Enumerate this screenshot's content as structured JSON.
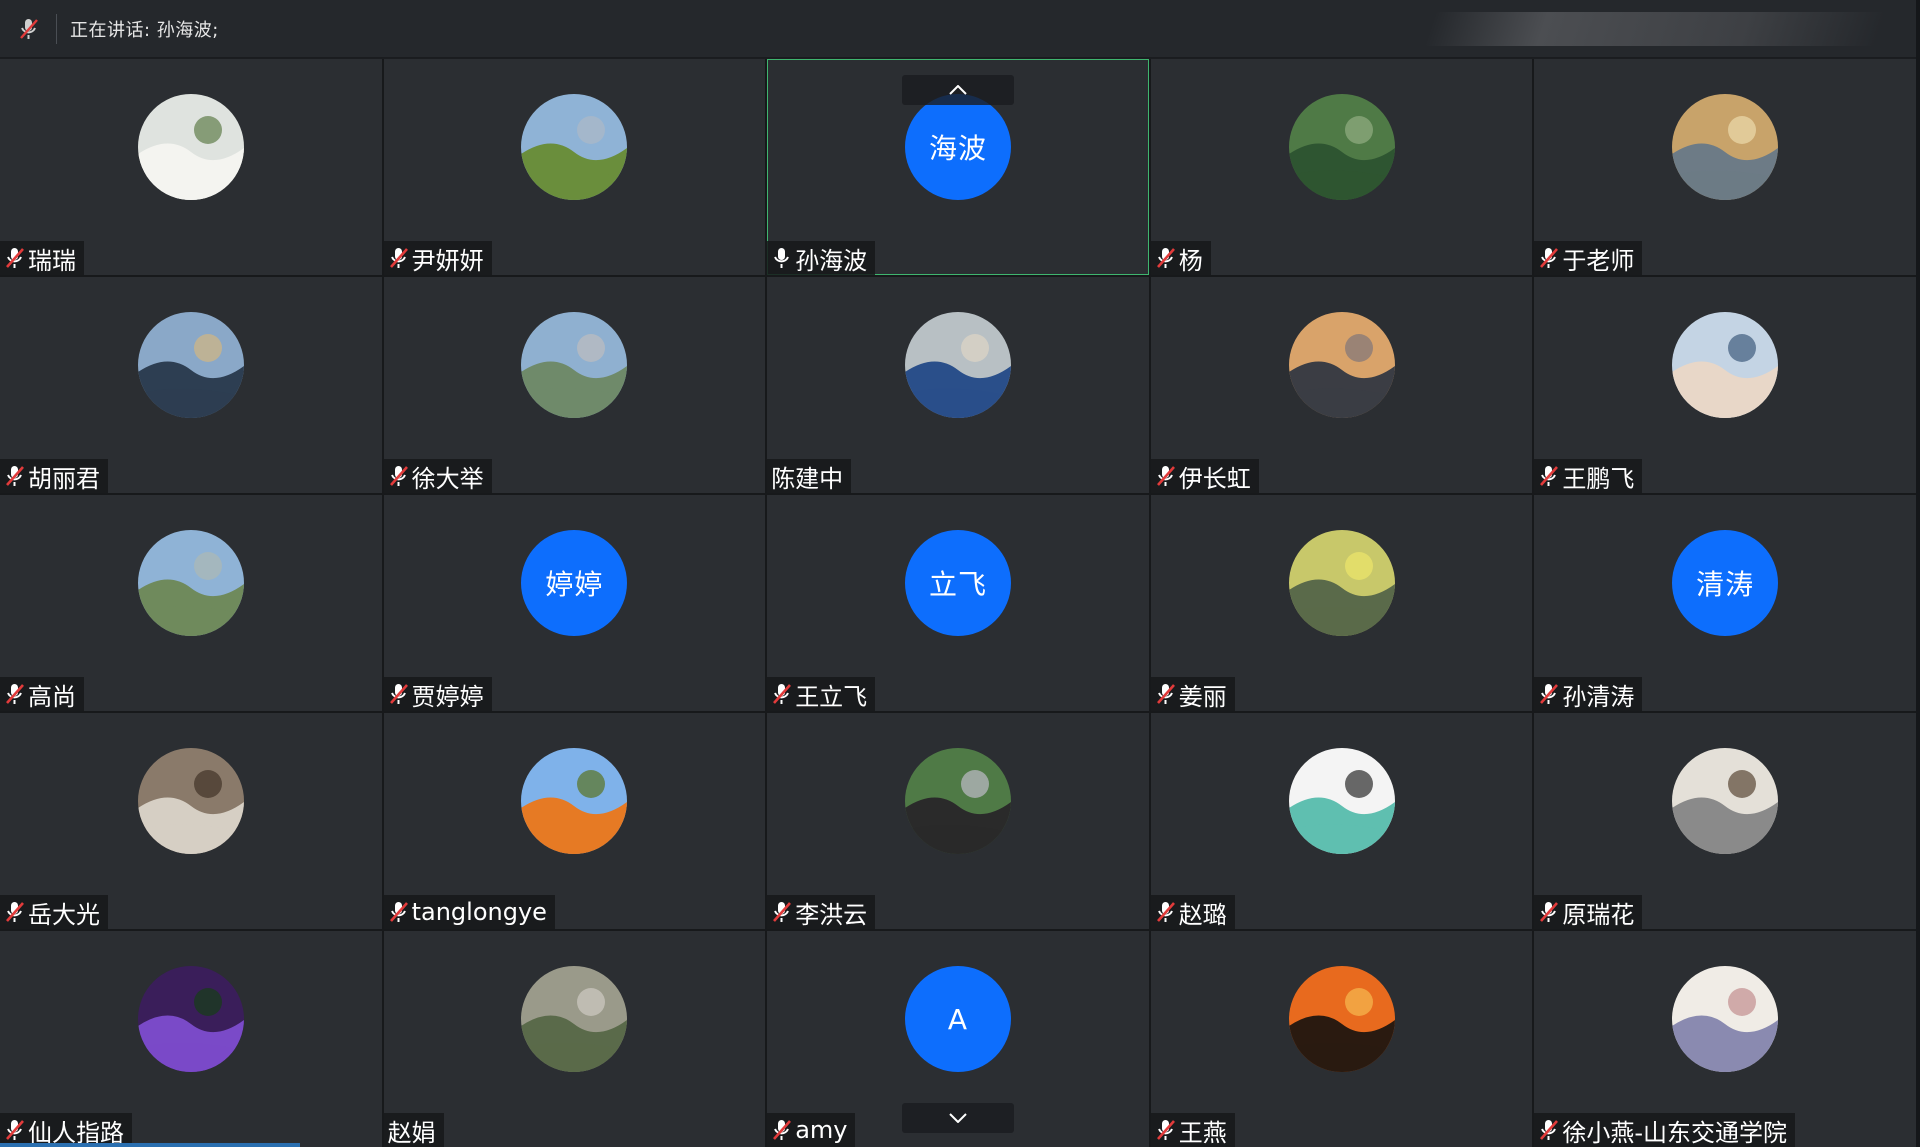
{
  "topbar": {
    "speaking_label": "正在讲话: 孙海波;",
    "mic_icon": "muted-mic-icon"
  },
  "colors": {
    "tile_bg": "#2b2e32",
    "avatar_blue": "#0d6efd",
    "active_border": "#3fb56f",
    "muted_red": "#e23b3b"
  },
  "navigation": {
    "up_icon": "chevron-up-icon",
    "down_icon": "chevron-down-icon"
  },
  "participants": [
    {
      "name": "瑞瑞",
      "muted": true,
      "avatar": "tea-cup-photo"
    },
    {
      "name": "尹妍妍",
      "muted": true,
      "avatar": "mountain-meadow-photo"
    },
    {
      "name": "孙海波",
      "muted": false,
      "speaking": true,
      "initials": "海波"
    },
    {
      "name": "杨",
      "muted": true,
      "avatar": "green-valley-photo"
    },
    {
      "name": "于老师",
      "muted": true,
      "avatar": "field-sunset-photo"
    },
    {
      "name": "胡丽君",
      "muted": true,
      "avatar": "pagoda-lake-photo"
    },
    {
      "name": "徐大举",
      "muted": true,
      "avatar": "highway-photo"
    },
    {
      "name": "陈建中",
      "muted": null,
      "avatar": "person-seaside-photo"
    },
    {
      "name": "伊长虹",
      "muted": true,
      "avatar": "sunset-hills-photo"
    },
    {
      "name": "王鹏飞",
      "muted": true,
      "avatar": "child-photo"
    },
    {
      "name": "高尚",
      "muted": true,
      "avatar": "river-photo"
    },
    {
      "name": "贾婷婷",
      "muted": true,
      "initials": "婷婷"
    },
    {
      "name": "王立飞",
      "muted": true,
      "initials": "立飞"
    },
    {
      "name": "姜丽",
      "muted": true,
      "avatar": "girl-umbrella-photo"
    },
    {
      "name": "孙清涛",
      "muted": true,
      "initials": "清涛"
    },
    {
      "name": "岳大光",
      "muted": true,
      "avatar": "tree-branches-photo"
    },
    {
      "name": "tanglongye",
      "muted": true,
      "avatar": "persimmons-photo"
    },
    {
      "name": "李洪云",
      "muted": true,
      "avatar": "steam-train-photo"
    },
    {
      "name": "赵璐",
      "muted": true,
      "avatar": "cartoon-sketch-photo"
    },
    {
      "name": "原瑞花",
      "muted": true,
      "avatar": "sitting-person-photo"
    },
    {
      "name": "仙人指路",
      "muted": true,
      "avatar": "purple-cabbage-photo"
    },
    {
      "name": "赵娟",
      "muted": null,
      "avatar": "street-photo"
    },
    {
      "name": "amy",
      "muted": true,
      "initials": "A"
    },
    {
      "name": "王燕",
      "muted": true,
      "avatar": "dandelion-sunset-photo"
    },
    {
      "name": "徐小燕-山东交通学院",
      "muted": true,
      "avatar": "illustration-girl-photo"
    }
  ]
}
